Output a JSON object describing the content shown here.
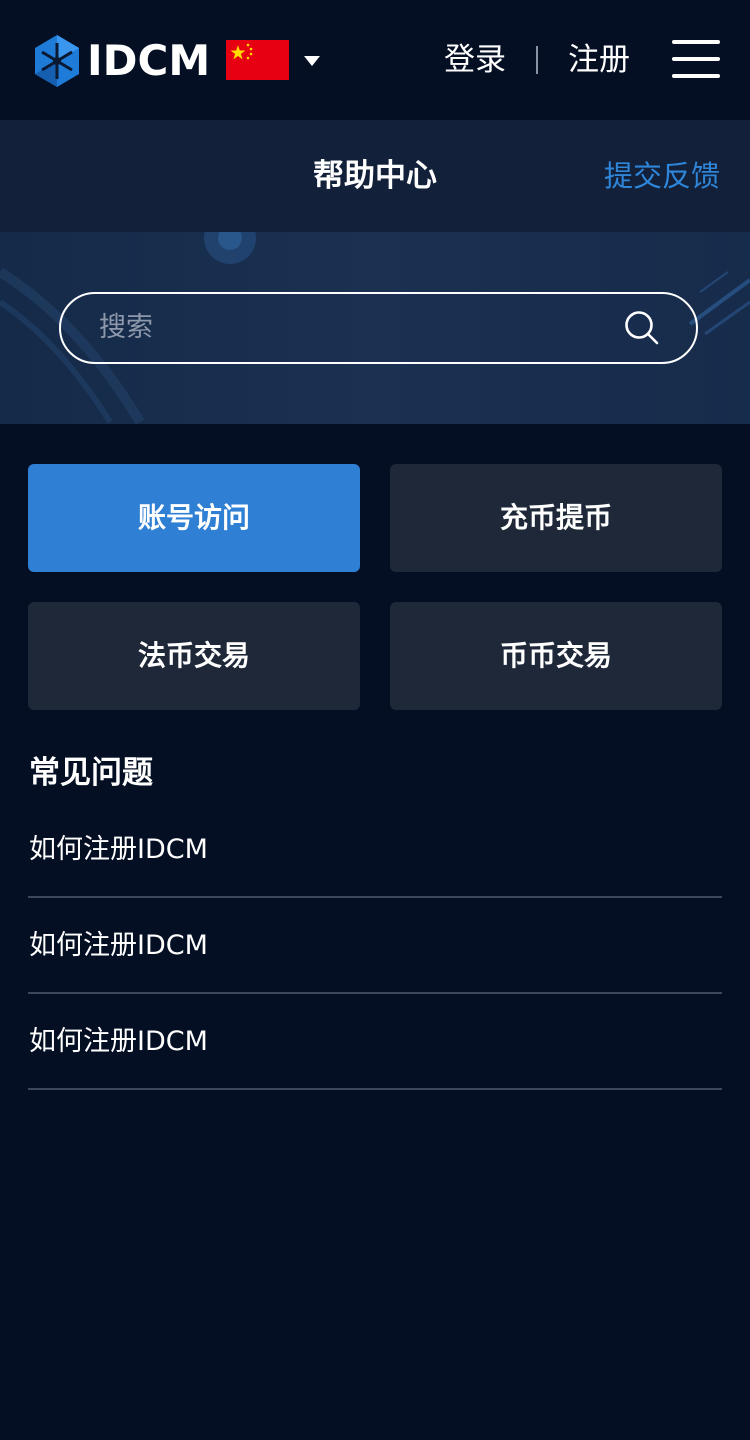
{
  "header": {
    "brand": "IDCM",
    "flag_icon": "china-flag-icon",
    "caret_icon": "caret-down-icon",
    "login_label": "登录",
    "register_label": "注册",
    "menu_icon": "hamburger-menu-icon"
  },
  "subheader": {
    "title": "帮助中心",
    "feedback_label": "提交反馈"
  },
  "search": {
    "placeholder": "搜索",
    "value": "",
    "icon": "search-icon"
  },
  "categories": [
    {
      "label": "账号访问",
      "active": true
    },
    {
      "label": "充币提币",
      "active": false
    },
    {
      "label": "法币交易",
      "active": false
    },
    {
      "label": "币币交易",
      "active": false
    }
  ],
  "faq": {
    "title": "常见问题",
    "items": [
      {
        "label": "如何注册IDCM"
      },
      {
        "label": "如何注册IDCM"
      },
      {
        "label": "如何注册IDCM"
      }
    ]
  },
  "colors": {
    "background": "#040f24",
    "subheader_bg": "#12203a",
    "accent": "#2f80d4",
    "link": "#2f86d8",
    "card_bg": "#1e2838",
    "divider": "#3a4659"
  }
}
